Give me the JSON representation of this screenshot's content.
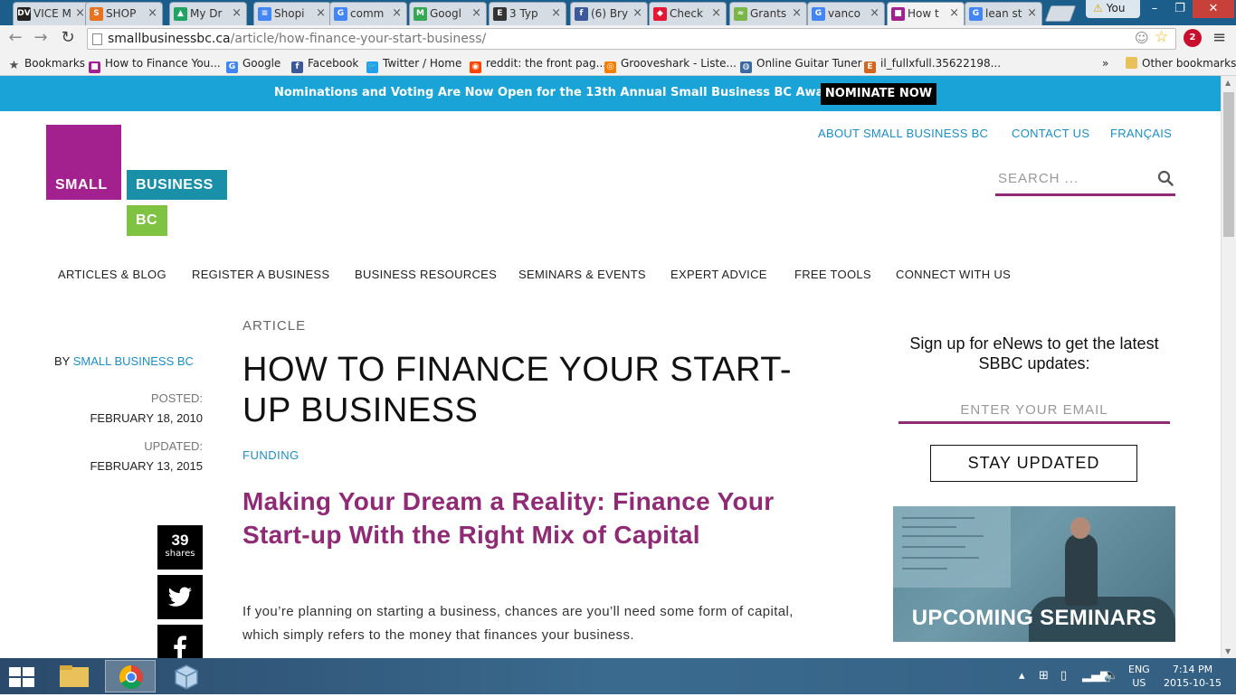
{
  "browser": {
    "tabs": [
      {
        "title": "VICE M",
        "fav_bg": "#222",
        "fav_text": "DV"
      },
      {
        "title": "SHOP",
        "fav_bg": "#e8731f",
        "fav_text": "S"
      },
      {
        "title": "My Dr",
        "fav_bg": "#1fa463",
        "fav_text": "▲"
      },
      {
        "title": "Shopi",
        "fav_bg": "#4285f4",
        "fav_text": "≡"
      },
      {
        "title": "comm",
        "fav_bg": "#4285f4",
        "fav_text": "G"
      },
      {
        "title": "Googl",
        "fav_bg": "#34a853",
        "fav_text": "M"
      },
      {
        "title": "3 Typ",
        "fav_bg": "#333",
        "fav_text": "E"
      },
      {
        "title": "(6) Bry",
        "fav_bg": "#3b5998",
        "fav_text": "f"
      },
      {
        "title": "Check",
        "fav_bg": "#e31837",
        "fav_text": "◆"
      },
      {
        "title": "Grants",
        "fav_bg": "#7ab648",
        "fav_text": "≈"
      },
      {
        "title": "vanco",
        "fav_bg": "#4285f4",
        "fav_text": "G"
      },
      {
        "title": "How t",
        "fav_bg": "#a3218f",
        "fav_text": "■"
      },
      {
        "title": "lean st",
        "fav_bg": "#4285f4",
        "fav_text": "G"
      }
    ],
    "user_label": "You",
    "url_domain": "smallbusinessbc.ca",
    "url_path": "/article/how-finance-your-start-business/",
    "adblock_count": "2",
    "bookmarks": [
      {
        "label": "Bookmarks",
        "icon": "apps-icon"
      },
      {
        "label": "How to Finance You...",
        "icon": "sbbc-icon"
      },
      {
        "label": "Google",
        "icon": "google-icon"
      },
      {
        "label": "Facebook",
        "icon": "facebook-icon"
      },
      {
        "label": "Twitter / Home",
        "icon": "twitter-icon"
      },
      {
        "label": "reddit: the front pag...",
        "icon": "reddit-icon"
      },
      {
        "label": "Grooveshark - Liste...",
        "icon": "grooveshark-icon"
      },
      {
        "label": "Online Guitar Tuner",
        "icon": "guitar-tuner-icon"
      },
      {
        "label": "il_fullxfull.35622198...",
        "icon": "etsy-icon"
      }
    ],
    "bookmarks_overflow": "»",
    "other_bookmarks": "Other bookmarks"
  },
  "promo": {
    "text": "Nominations and Voting Are Now Open for the 13th Annual Small Business BC Awards!",
    "button": "NOMINATE NOW"
  },
  "logo": {
    "small": "SMALL",
    "business": "BUSINESS",
    "bc": "BC"
  },
  "util_nav": [
    "ABOUT SMALL BUSINESS BC",
    "CONTACT US",
    "FRANÇAIS"
  ],
  "search": {
    "placeholder": "SEARCH ..."
  },
  "main_nav": [
    "ARTICLES & BLOG",
    "REGISTER A BUSINESS",
    "BUSINESS RESOURCES",
    "SEMINARS & EVENTS",
    "EXPERT ADVICE",
    "FREE TOOLS",
    "CONNECT WITH US"
  ],
  "meta": {
    "by_prefix": "BY",
    "author": "SMALL BUSINESS BC",
    "posted_label": "POSTED:",
    "posted_date": "FEBRUARY 18, 2010",
    "updated_label": "UPDATED:",
    "updated_date": "FEBRUARY 13, 2015"
  },
  "share": {
    "count": "39",
    "count_label": "shares"
  },
  "article": {
    "kicker": "ARTICLE",
    "title": "HOW TO FINANCE YOUR START-UP BUSINESS",
    "tag": "FUNDING",
    "subtitle": "Making Your Dream a Reality: Finance Your Start-up With the Right Mix of Capital",
    "body": "If you’re planning on starting a business, chances are you’ll need some form of capital, which simply refers to the money that finances your business."
  },
  "sidebar": {
    "enews_heading": "Sign up for eNews to get the latest SBBC updates:",
    "email_placeholder": "ENTER YOUR EMAIL",
    "stay_button": "STAY UPDATED",
    "seminar_label": "UPCOMING SEMINARS"
  },
  "taskbar": {
    "lang_top": "ENG",
    "lang_bottom": "US",
    "time": "7:14 PM",
    "date": "2015-10-15"
  },
  "colors": {
    "promo_bg": "#19a3d6",
    "brand_magenta": "#a3218f",
    "brand_teal": "#1a8fa8",
    "brand_green": "#80c342",
    "link_blue": "#1a8fc4",
    "subtitle_purple": "#8f2a75"
  }
}
